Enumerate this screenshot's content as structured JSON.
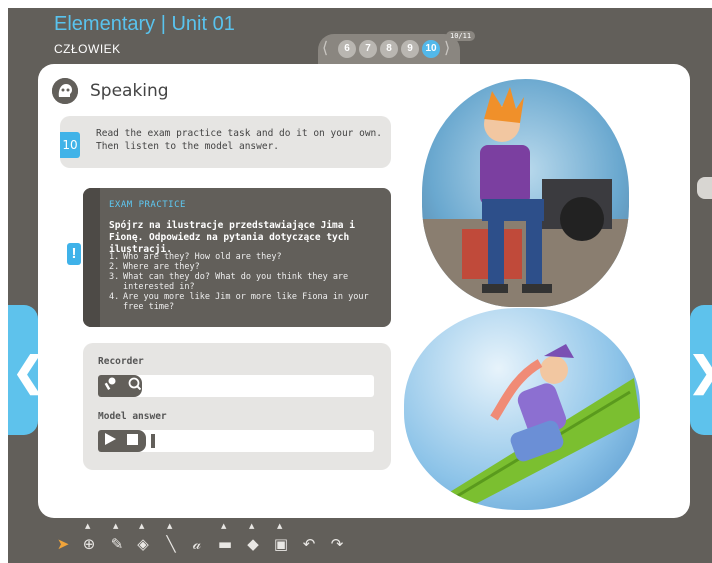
{
  "header": {
    "title": "Elementary | Unit 01",
    "subtitle": "CZŁOWIEK",
    "pages": [
      "6",
      "7",
      "8",
      "9",
      "10"
    ],
    "active_page": "10",
    "page_count": "10/11",
    "prev_glyph": "⟨",
    "next_glyph": "⟩"
  },
  "section": {
    "label": "Speaking"
  },
  "task": {
    "number": "10",
    "text": "Read the exam practice task and do it on your own. Then listen to the model answer."
  },
  "exam": {
    "heading": "EXAM PRACTICE",
    "instruction": "Spójrz na ilustracje przedstawiające Jima i Fionę. Odpowiedz na pytania dotyczące tych ilustracji.",
    "questions": [
      {
        "num": "1.",
        "text": "Who are they? How old are they?"
      },
      {
        "num": "2.",
        "text": "Where are they?"
      },
      {
        "num": "3.",
        "text": "What can they do? What do you think they are interested in?"
      },
      {
        "num": "4.",
        "text": "Are you more like Jim or more like Fiona in your free time?"
      }
    ],
    "alert_glyph": "!"
  },
  "audio": {
    "recorder_label": "Recorder",
    "model_label": "Model answer"
  },
  "colors": {
    "frame": "#625f5a",
    "accent": "#41b3e8",
    "card": "#e6e5e3"
  },
  "icons": {
    "speaking": "head-silhouette-icon",
    "microphone": "microphone-icon",
    "search": "search-icon",
    "play": "play-icon",
    "stop": "stop-icon"
  }
}
